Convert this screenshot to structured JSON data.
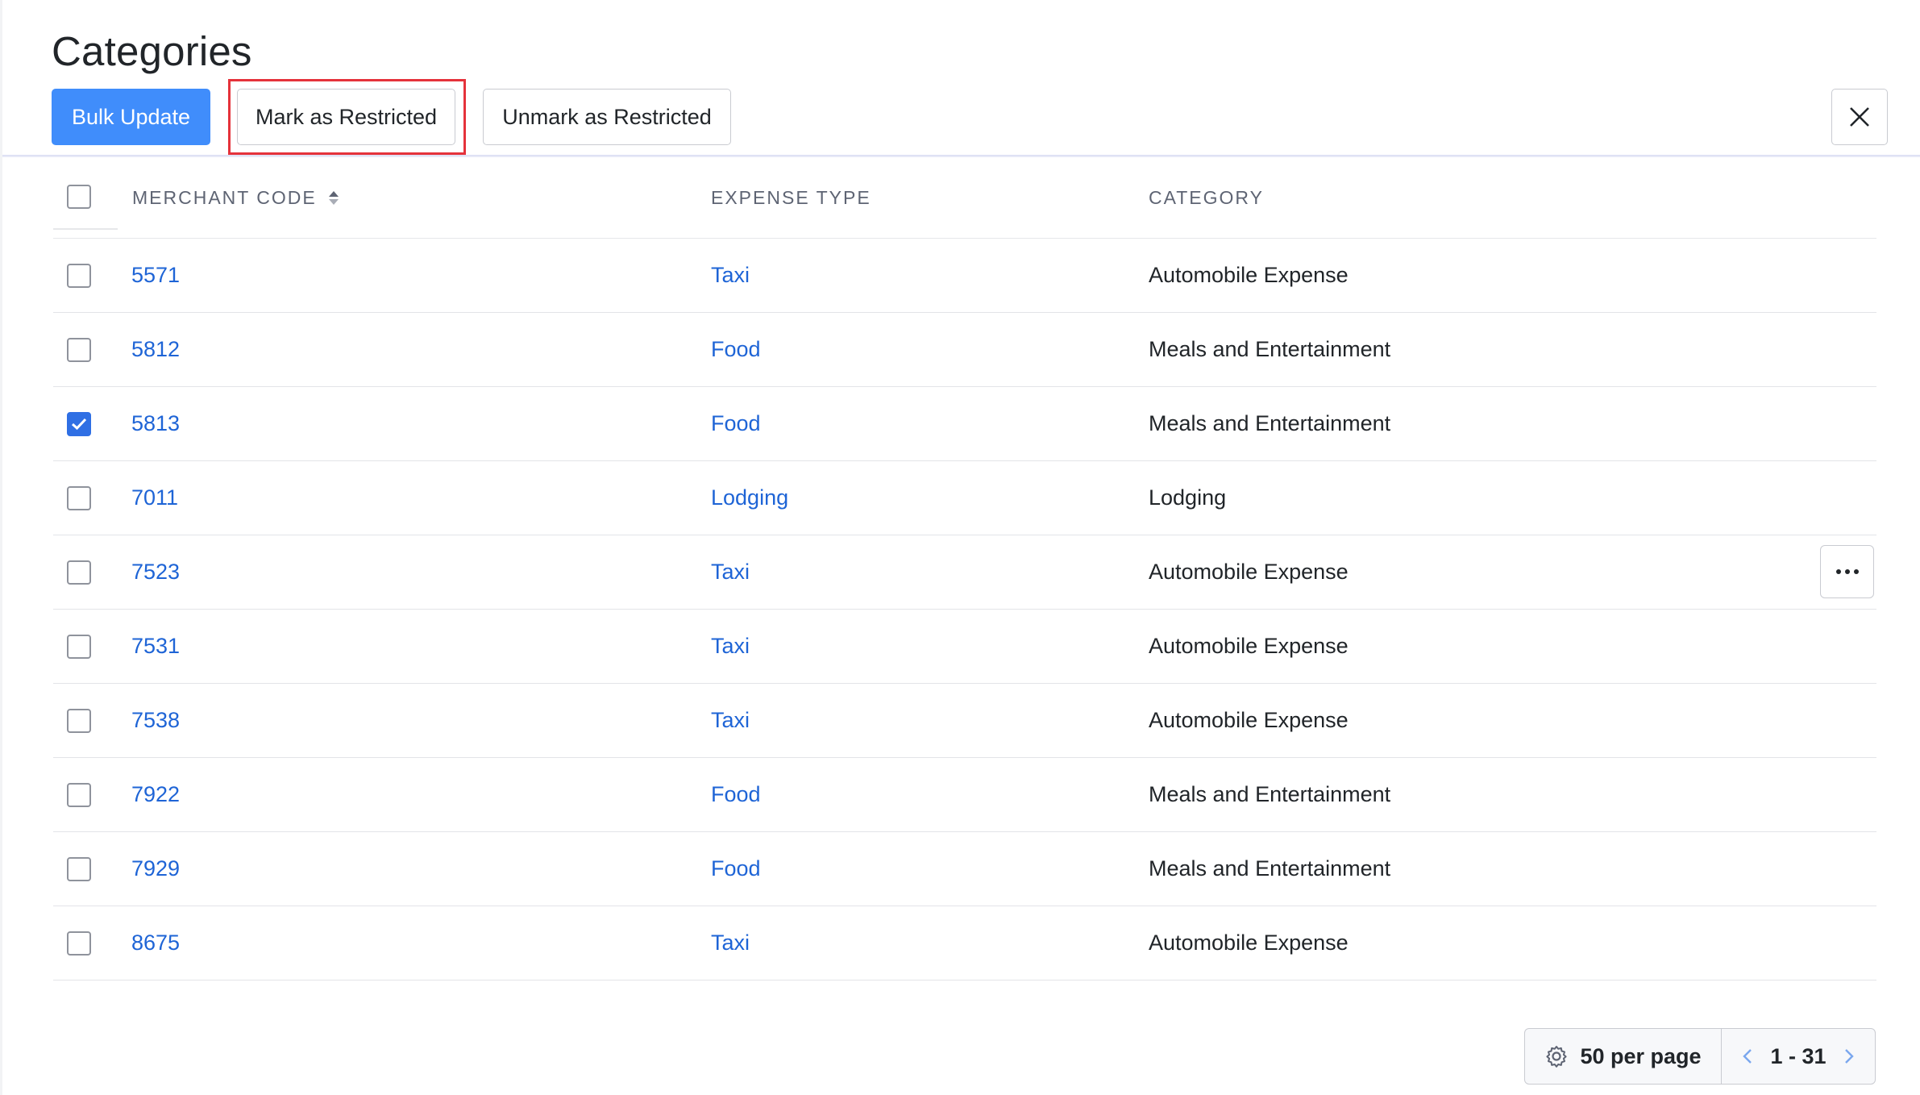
{
  "page": {
    "title": "Categories"
  },
  "toolbar": {
    "bulk_update_label": "Bulk Update",
    "mark_restricted_label": "Mark as Restricted",
    "unmark_restricted_label": "Unmark as Restricted",
    "close_icon": "close-icon"
  },
  "table": {
    "columns": {
      "merchant_code": "MERCHANT CODE",
      "expense_type": "EXPENSE TYPE",
      "category": "CATEGORY"
    },
    "rows": [
      {
        "code": "5571",
        "type": "Taxi",
        "category": "Automobile Expense",
        "checked": false
      },
      {
        "code": "5812",
        "type": "Food",
        "category": "Meals and Entertainment",
        "checked": false
      },
      {
        "code": "5813",
        "type": "Food",
        "category": "Meals and Entertainment",
        "checked": true
      },
      {
        "code": "7011",
        "type": "Lodging",
        "category": "Lodging",
        "checked": false
      },
      {
        "code": "7523",
        "type": "Taxi",
        "category": "Automobile Expense",
        "checked": false,
        "hovered": true
      },
      {
        "code": "7531",
        "type": "Taxi",
        "category": "Automobile Expense",
        "checked": false
      },
      {
        "code": "7538",
        "type": "Taxi",
        "category": "Automobile Expense",
        "checked": false
      },
      {
        "code": "7922",
        "type": "Food",
        "category": "Meals and Entertainment",
        "checked": false
      },
      {
        "code": "7929",
        "type": "Food",
        "category": "Meals and Entertainment",
        "checked": false
      },
      {
        "code": "8675",
        "type": "Taxi",
        "category": "Automobile Expense",
        "checked": false
      }
    ]
  },
  "pagination": {
    "per_page_label": "50 per page",
    "range_label": "1 - 31"
  },
  "colors": {
    "primary": "#408dfb",
    "link": "#1e64d6",
    "highlight": "#e5323b",
    "checkbox_checked": "#2f6fe4"
  }
}
